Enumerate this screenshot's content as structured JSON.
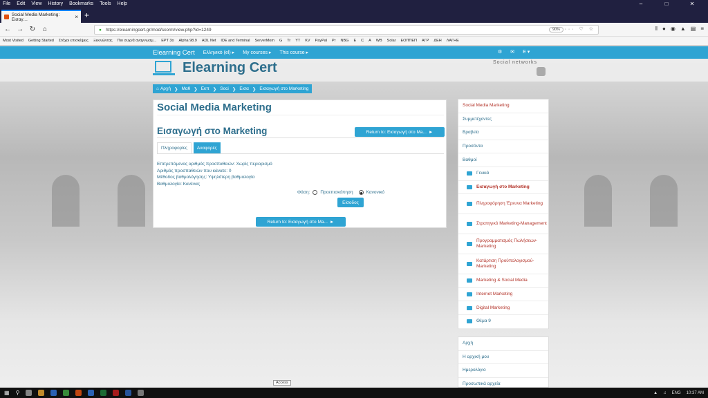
{
  "browser": {
    "menu": [
      "File",
      "Edit",
      "View",
      "History",
      "Bookmarks",
      "Tools",
      "Help"
    ],
    "tab_title": "Social Media Marketing: Εισαγ…",
    "url": "https://elearningcert.gr/mod/scorm/view.php?id=1249",
    "zoom": "90%",
    "bookmarks": [
      "Most Visited",
      "Getting Started",
      "Στόχοι επισκέψεις",
      "Ξεκινώντας",
      "Πιο συχνά αναγνωσμ...",
      "EPT 3o",
      "Alpha 98.9",
      "ADL Net",
      "IDE and Terminal",
      "ServerMom",
      "G",
      "Tr",
      "YT",
      "KV",
      "PayPal",
      "Pr",
      "NBG",
      "E",
      "C",
      "A",
      "WB",
      "Solar",
      "ΕΟΠΠΕΠ",
      "ΑΓΡ",
      "ΔΕΗ",
      "ΛΑΓΗΕ"
    ]
  },
  "site_nav": {
    "brand": "Elearning Cert",
    "language": "Ελληνικό (el) ▸",
    "my_courses": "My courses ▸",
    "this_course": "This course ▸",
    "user": "Ε ▾"
  },
  "header": {
    "title": "Elearning Cert",
    "social": "Social networks"
  },
  "breadcrumb": [
    "Αρχή",
    "Μαθ",
    "Εκπ",
    "Soci",
    "Εισα",
    "Εισαγωγή στο Marketing"
  ],
  "main": {
    "course_title": "Social Media Marketing",
    "activity_title": "Εισαγωγή στο Marketing",
    "return_label": "Return to: Εισαγωγή στο Ma...",
    "tab_info": "Πληροφορίες",
    "tab_reports": "Αναφορές",
    "info_lines": [
      "Επιτρεπόμενος αριθμός προσπαθειών: Χωρίς περιορισμό",
      "Αριθμός προσπαθειών που κάνατε: 0",
      "Μέθοδος βαθμολόγησης: Υψηλότερη βαθμολογία",
      "Βαθμολογία: Κανένας"
    ],
    "mode_label": "Φάση:",
    "mode_preview": "Προεπισκόπηση",
    "mode_normal": "Κανονικό",
    "enter_label": "Είσοδος"
  },
  "sidebar": {
    "items": [
      {
        "label": "Social Media Marketing",
        "type": "top",
        "red": true
      },
      {
        "label": "Συμμετέχοντες",
        "type": "top"
      },
      {
        "label": "Βραβεία",
        "type": "top"
      },
      {
        "label": "Προσόντα",
        "type": "top"
      },
      {
        "label": "Βαθμοί",
        "type": "top"
      },
      {
        "label": "Γενικά",
        "type": "sub"
      },
      {
        "label": "Εισαγωγή στο Marketing",
        "type": "sub",
        "red": true,
        "bold": true
      },
      {
        "label": "Πληροφόρηση Έρευνα Marketing",
        "type": "sub",
        "red": true,
        "tall": true
      },
      {
        "label": "Στρατηγικό Marketing-Management",
        "type": "sub",
        "red": true,
        "tall": true
      },
      {
        "label": "Προγραμματισμός Πωλήσεων-Marketing",
        "type": "sub",
        "red": true,
        "tall": true
      },
      {
        "label": "Κατάρτιση Προϋπολογισμού-Marketing",
        "type": "sub",
        "red": true,
        "tall": true
      },
      {
        "label": "Marketing & Social Media",
        "type": "sub",
        "red": true
      },
      {
        "label": "Internet Marketing",
        "type": "sub",
        "red": true
      },
      {
        "label": "Digital Marketing",
        "type": "sub",
        "red": true
      },
      {
        "label": "Θέμα 9",
        "type": "sub"
      }
    ],
    "items2": [
      "Αρχή",
      "Η αρχική μου",
      "Ημερολόγιο",
      "Προσωπικά αρχεία"
    ]
  },
  "tooltip": "Access",
  "taskbar": {
    "lang": "ENG",
    "time": "10:37 AM"
  },
  "colors": {
    "accent": "#2fa4d3",
    "title": "#2d6e8c",
    "link_red": "#b3342a"
  }
}
